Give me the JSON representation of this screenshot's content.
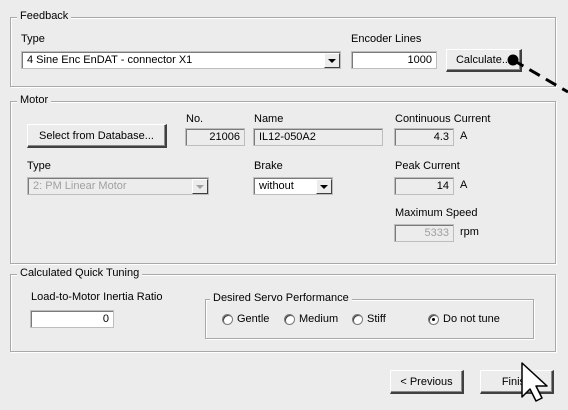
{
  "feedback": {
    "group_label": "Feedback",
    "type_label": "Type",
    "type_value": "4 Sine Enc EnDAT - connector X1",
    "encoder_lines_label": "Encoder Lines",
    "encoder_lines_value": "1000",
    "calculate_button": "Calculate..."
  },
  "motor": {
    "group_label": "Motor",
    "select_db_button": "Select from Database...",
    "no_label": "No.",
    "no_value": "21006",
    "name_label": "Name",
    "name_value": "IL12-050A2",
    "continuous_current_label": "Continuous Current",
    "continuous_current_value": "4.3",
    "continuous_current_unit": "A",
    "type_label": "Type",
    "type_value": "2: PM Linear Motor",
    "brake_label": "Brake",
    "brake_value": "without",
    "peak_current_label": "Peak Current",
    "peak_current_value": "14",
    "peak_current_unit": "A",
    "max_speed_label": "Maximum Speed",
    "max_speed_value": "5333",
    "max_speed_unit": "rpm"
  },
  "tuning": {
    "group_label": "Calculated Quick Tuning",
    "inertia_label": "Load-to-Motor Inertia Ratio",
    "inertia_value": "0",
    "servo_group_label": "Desired Servo Performance",
    "options": [
      "Gentle",
      "Medium",
      "Stiff",
      "Do not tune"
    ],
    "selected": "Do not tune"
  },
  "footer": {
    "previous_button": "< Previous",
    "finish_button": "Finish"
  }
}
